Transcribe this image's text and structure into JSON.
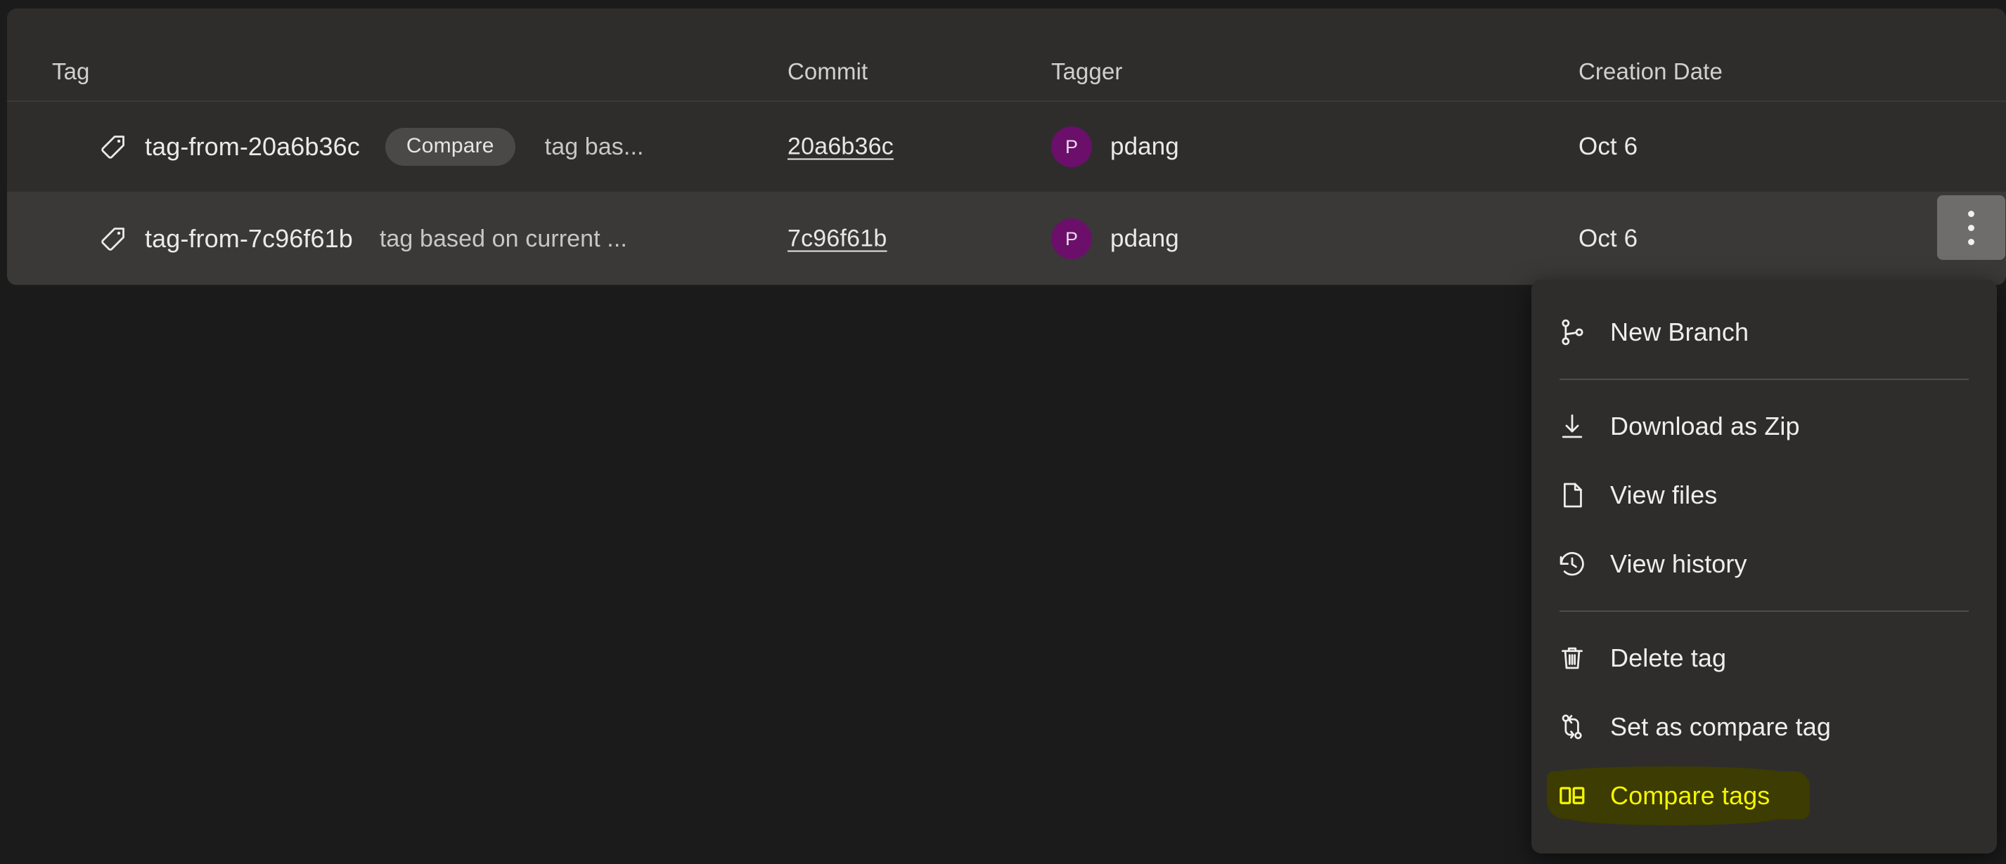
{
  "table": {
    "columns": [
      {
        "key": "tag",
        "label": "Tag"
      },
      {
        "key": "commit",
        "label": "Commit"
      },
      {
        "key": "tagger",
        "label": "Tagger"
      },
      {
        "key": "date",
        "label": "Creation Date"
      }
    ],
    "rows": [
      {
        "tag_name": "tag-from-20a6b36c",
        "badge": "Compare",
        "message": "tag bas...",
        "commit": "20a6b36c",
        "tagger_initial": "P",
        "tagger": "pdang",
        "date": "Oct 6"
      },
      {
        "tag_name": "tag-from-7c96f61b",
        "badge": "",
        "message": "tag based on current ...",
        "commit": "7c96f61b",
        "tagger_initial": "P",
        "tagger": "pdang",
        "date": "Oct 6"
      }
    ]
  },
  "kebab": {
    "name": "more-actions"
  },
  "context_menu": {
    "items": [
      {
        "icon": "branch-icon",
        "label": "New Branch"
      },
      {
        "icon": "download-icon",
        "label": "Download as Zip"
      },
      {
        "icon": "file-icon",
        "label": "View files"
      },
      {
        "icon": "history-icon",
        "label": "View history"
      },
      {
        "icon": "trash-icon",
        "label": "Delete tag"
      },
      {
        "icon": "compare-branch-icon",
        "label": "Set as compare tag"
      },
      {
        "icon": "compare-tags-icon",
        "label": "Compare tags"
      }
    ]
  },
  "colors": {
    "page_background": "#1b1b1b",
    "card_background": "#2e2d2c",
    "row_hover": "#3a3938",
    "avatar": "#6b0f6b",
    "badge": "#4a4947",
    "kebab": "#6e6d6c",
    "highlight_text": "#f5f500",
    "highlight_marker": "#3c3c03",
    "text_primary": "#eceae8",
    "text_secondary": "#c9c7c5"
  }
}
